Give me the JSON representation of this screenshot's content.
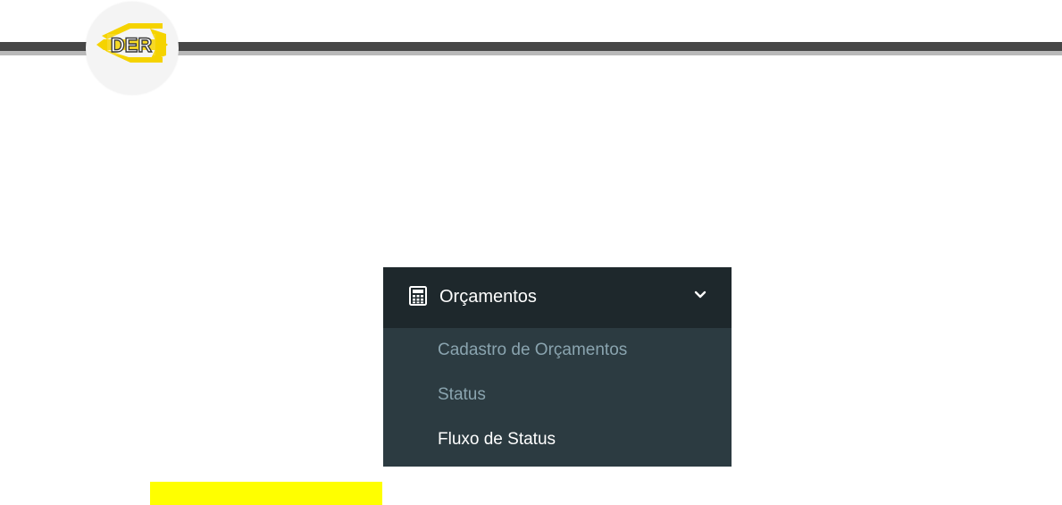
{
  "logo": {
    "text": "DER",
    "brand_color": "#f5d300",
    "icon": "der-logo-icon"
  },
  "header": {
    "dark_color": "#464646",
    "light_color": "#b9b9b9"
  },
  "menu": {
    "title": "Orçamentos",
    "icon": "calculator-icon",
    "expand_icon": "chevron-down-icon",
    "expanded": true,
    "background": "#2c3b41",
    "header_background": "#1e282c",
    "items": [
      {
        "label": "Cadastro de Orçamentos",
        "active": false
      },
      {
        "label": "Status",
        "active": false
      },
      {
        "label": "Fluxo de Status",
        "active": true
      }
    ]
  },
  "highlight": {
    "color": "#ffff00"
  }
}
